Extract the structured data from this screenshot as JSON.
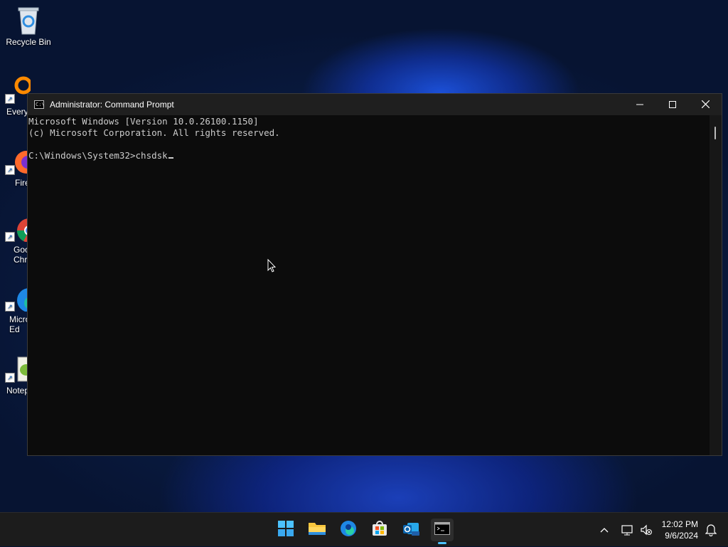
{
  "desktop": {
    "icons": [
      {
        "label": "Recycle Bin"
      },
      {
        "label": "Every"
      },
      {
        "label": "Fire"
      },
      {
        "label": "Goo\nChro"
      },
      {
        "label": "Micro\nEd"
      },
      {
        "label": "Notep"
      }
    ]
  },
  "window": {
    "title": "Administrator: Command Prompt",
    "icon_text": "C:\\",
    "controls": {
      "minimize": "—",
      "maximize": "☐",
      "close": "✕"
    }
  },
  "console": {
    "lines": [
      "Microsoft Windows [Version 10.0.26100.1150]",
      "(c) Microsoft Corporation. All rights reserved.",
      "",
      "C:\\Windows\\System32>chsdsk"
    ]
  },
  "taskbar": {
    "apps": [
      "start-icon",
      "file-explorer-icon",
      "edge-icon",
      "store-icon",
      "outlook-icon",
      "terminal-icon"
    ],
    "active_app": "terminal-icon"
  },
  "tray": {
    "time": "12:02 PM",
    "date": "9/6/2024"
  },
  "colors": {
    "console_bg": "#0c0c0c",
    "console_text": "#cccccc",
    "taskbar_bg": "#1c1c1c",
    "accent": "#4cc2ff"
  }
}
